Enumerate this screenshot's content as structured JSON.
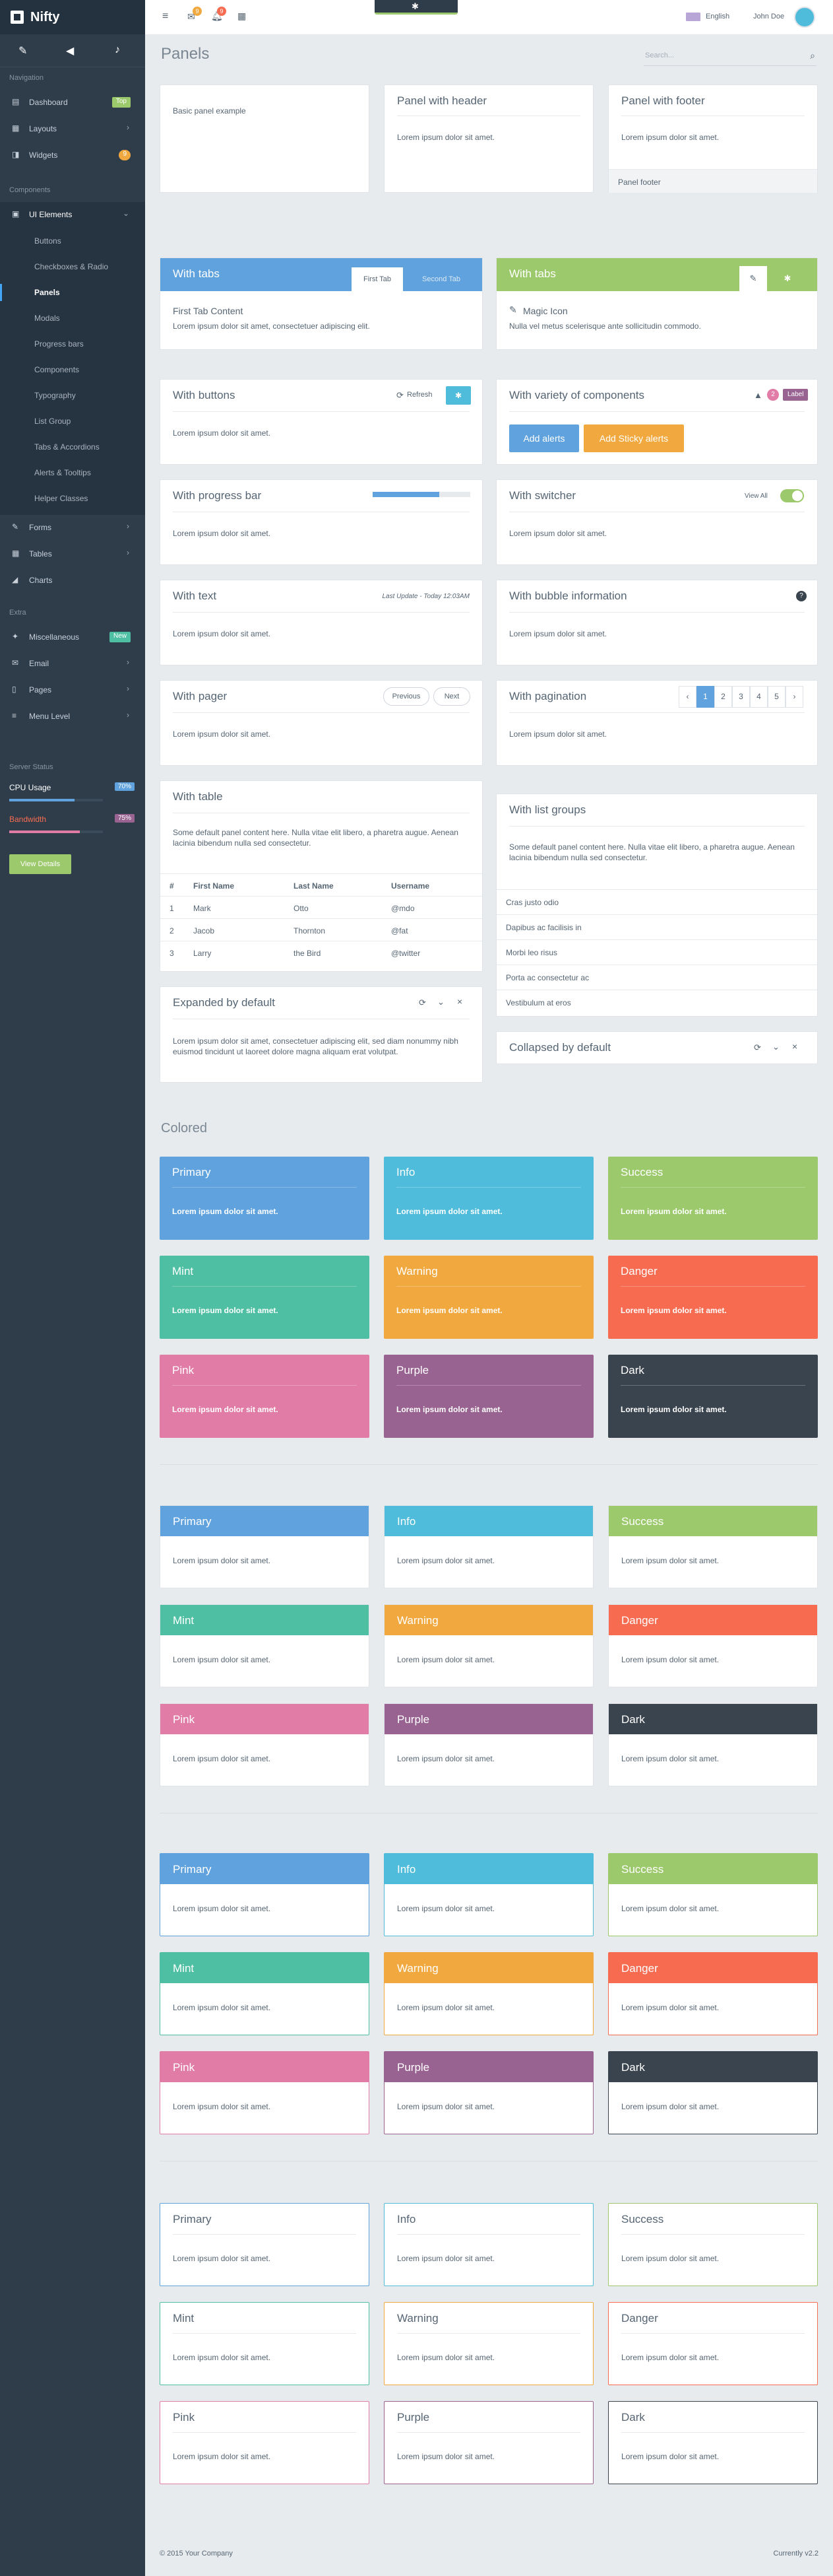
{
  "brand": {
    "name": "Nifty"
  },
  "sidebar": {
    "headers": {
      "navigation": "Navigation",
      "components": "Components",
      "extra": "Extra",
      "server": "Server Status"
    },
    "nav": [
      {
        "label": "Dashboard",
        "badge": "Top"
      },
      {
        "label": "Layouts"
      },
      {
        "label": "Widgets",
        "badge": "9"
      }
    ],
    "ui_elements": "UI Elements",
    "sub": [
      "Buttons",
      "Checkboxes & Radio",
      "Panels",
      "Modals",
      "Progress bars",
      "Components",
      "Typography",
      "List Group",
      "Tabs & Accordions",
      "Alerts & Tooltips",
      "Helper Classes"
    ],
    "components2": [
      "Forms",
      "Tables",
      "Charts"
    ],
    "extra": [
      {
        "label": "Miscellaneous",
        "badge": "New"
      },
      {
        "label": "Email"
      },
      {
        "label": "Pages"
      },
      {
        "label": "Menu Level"
      }
    ],
    "cpu_label": "CPU Usage",
    "cpu_value": "70%",
    "cpu_progress": 0.7,
    "bandwidth_label": "Bandwidth",
    "bandwidth_value": "75%",
    "bandwidth_progress": 0.75,
    "view_details": "View Details"
  },
  "topbar": {
    "messages_count": "9",
    "notifications_count": "9",
    "language": "English",
    "user": "John Doe"
  },
  "page": {
    "title": "Panels",
    "search_placeholder": "Search..."
  },
  "panels": {
    "lorem": "Lorem ipsum dolor sit amet.",
    "basic": "Basic panel example",
    "with_header": "Panel with header",
    "with_footer": "Panel with footer",
    "footer_text": "Panel footer",
    "with_tabs": "With tabs",
    "first_tab": "First Tab",
    "second_tab": "Second Tab",
    "first_tab_content": "First Tab Content",
    "tab_text": "Lorem ipsum dolor sit amet, consectetuer adipiscing elit.",
    "magic_icon": "Magic Icon",
    "magic_text": "Nulla vel metus scelerisque ante sollicitudin commodo.",
    "with_buttons": "With buttons",
    "refresh": "Refresh",
    "with_variety": "With variety of components",
    "variety_count": "2",
    "variety_label": "Label",
    "add_alerts": "Add alerts",
    "add_sticky": "Add Sticky alerts",
    "with_progress": "With progress bar",
    "progress_value": 0.68,
    "with_switcher": "With switcher",
    "view_all": "View All",
    "with_text": "With text",
    "last_update": "Last Update - Today 12:03AM",
    "with_bubble": "With bubble information",
    "with_pager": "With pager",
    "previous": "Previous",
    "next": "Next",
    "with_pagination": "With pagination",
    "pagination": [
      "‹",
      "1",
      "2",
      "3",
      "4",
      "5",
      "›"
    ],
    "with_table": "With table",
    "table_text": "Some default panel content here. Nulla vitae elit libero, a pharetra augue. Aenean lacinia bibendum nulla sed consectetur.",
    "table_headers": [
      "#",
      "First Name",
      "Last Name",
      "Username"
    ],
    "table_rows": [
      [
        "1",
        "Mark",
        "Otto",
        "@mdo"
      ],
      [
        "2",
        "Jacob",
        "Thornton",
        "@fat"
      ],
      [
        "3",
        "Larry",
        "the Bird",
        "@twitter"
      ]
    ],
    "with_list": "With list groups",
    "list_text": "Some default panel content here. Nulla vitae elit libero, a pharetra augue. Aenean lacinia bibendum nulla sed consectetur.",
    "list_items": [
      "Cras justo odio",
      "Dapibus ac facilisis in",
      "Morbi leo risus",
      "Porta ac consectetur ac",
      "Vestibulum at eros"
    ],
    "expanded": "Expanded by default",
    "expanded_text": "Lorem ipsum dolor sit amet, consectetuer adipiscing elit, sed diam nonummy nibh euismod tincidunt ut laoreet dolore magna aliquam erat volutpat.",
    "collapsed": "Collapsed by default"
  },
  "colored": {
    "section_title": "Colored",
    "names": [
      "Primary",
      "Info",
      "Success",
      "Mint",
      "Warning",
      "Danger",
      "Pink",
      "Purple",
      "Dark"
    ],
    "colors": [
      "#5fa2dd",
      "#4ebcda",
      "#9cc96b",
      "#4ebfa2",
      "#f1a93f",
      "#f76c51",
      "#e17ca7",
      "#986291",
      "#3a444e"
    ]
  },
  "footer": {
    "copyright": "© 2015 Your Company",
    "version": "Currently v2.2"
  }
}
